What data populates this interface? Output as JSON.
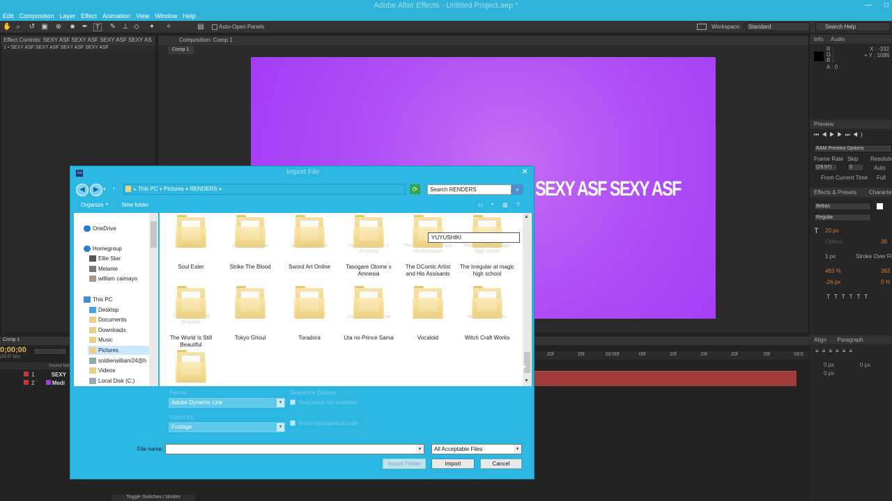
{
  "app": {
    "title": "Adobe After Effects - Untitled Project.aep *",
    "window_min": "—",
    "window_max": "□"
  },
  "menu": [
    "Edit",
    "Composition",
    "Layer",
    "Effect",
    "Animation",
    "View",
    "Window",
    "Help"
  ],
  "toolbar": {
    "auto_open": "Auto-Open Panels",
    "workspace_label": "Workspace:",
    "workspace_value": "Standard",
    "search_help": "Search Help"
  },
  "left_panel": {
    "tab": "Effect Controls: SEXY ASF SEXY ASF SEXY ASF SEXY AS",
    "breadcrumb": "1 • SEXY ASF SEXY ASF SEXY ASF SEXY ASF"
  },
  "comp_panel": {
    "tab": "Composition: Comp 1",
    "subtab": "Comp 1",
    "text": "SEXY ASF SEXY ASF"
  },
  "timeline": {
    "tab": "Comp 1",
    "time": "0;00;00",
    "fps": "(29.97 fps)",
    "col_source": "Source Nam",
    "layers": [
      {
        "num": "1",
        "name": "SEXY"
      },
      {
        "num": "2",
        "name": "Medi"
      }
    ],
    "ruler": [
      "20f",
      "25f",
      "02:00f",
      "05f",
      "10f",
      "15f",
      "20f",
      "25f",
      "03:0"
    ],
    "toggle": "Toggle Switches / Modes"
  },
  "right_panel": {
    "info_tab": "Info",
    "audio_tab": "Audio",
    "r": "R :",
    "g": "G :",
    "b": "B :",
    "a": "A : 0",
    "x": "X : -332",
    "y": "+ Y : 1086",
    "preview_tab": "Preview",
    "ram": "RAM Preview Options",
    "frame_rate": "Frame Rate",
    "skip": "Skip",
    "resolution": "Resolutio",
    "fr_val": "(29.97)",
    "skip_val": "0",
    "res_val": "Auto",
    "from_current": "From Current Time",
    "full": "Full",
    "effects_tab": "Effects & Presets",
    "char_tab": "Characte",
    "font": "Bebas",
    "style": "Regular",
    "size": "20 px",
    "tracking": "Optical",
    "leading": "36",
    "stroke": "1 px",
    "stroke_over": "Stroke Over Fil",
    "vscale": "483 %",
    "hscale": "363",
    "baseline": "-26 px",
    "tsume": "0 %",
    "align_tab": "Align",
    "para_tab": "Paragraph",
    "indent1": "0 px",
    "indent2": "0 px",
    "indent3": "0 px"
  },
  "dialog": {
    "title": "Import File",
    "close": "✕",
    "breadcrumb": [
      "This PC",
      "Pictures",
      "RENDERS"
    ],
    "search_placeholder": "Search RENDERS",
    "organize": "Organize",
    "new_folder": "New folder",
    "nav": [
      "OneDrive",
      "Homegroup",
      "Ellie Star",
      "Melanie",
      "william caimayo",
      "This PC",
      "Desktop",
      "Documents",
      "Downloads",
      "Music",
      "Pictures",
      "soldierwilliam24@h",
      "Videos",
      "Local Disk (C:)"
    ],
    "folders": [
      {
        "label": "Soul Eater",
        "ghost": "Soul Eater"
      },
      {
        "label": "Strike The Blood",
        "ghost": "Strike The Blood"
      },
      {
        "label": "Sword Art Online",
        "ghost": "Sword Art Online"
      },
      {
        "label": "Tasogare Otome x Amnesia",
        "ghost": "Tasogare Otome x Amnesia"
      },
      {
        "label": "The DComic Artist and His Assisants",
        "ghost": "The DComic Artist and His Assisants"
      },
      {
        "label": "The Irregular at magic high school",
        "ghost": "The Irregular at magic high school"
      },
      {
        "label": "The World Is Still Beautiful",
        "ghost": "The World Is Still Beautiful"
      },
      {
        "label": "Tokyo Ghoul",
        "ghost": "Tokyo Ghoul"
      },
      {
        "label": "Toradora",
        "ghost": "Toradora"
      },
      {
        "label": "Uta no Prince Sama",
        "ghost": "Uta no Prince Sama"
      },
      {
        "label": "Vocaloid",
        "ghost": "Vocaloid"
      },
      {
        "label": "Witch Craft Works",
        "ghost": "Witch Craft Works"
      },
      {
        "label": "",
        "ghost": "YUYUSHIKI"
      }
    ],
    "rename_value": "YUYUSHIKI",
    "format_label": "Format:",
    "format_value": "Adobe Dynamic Link",
    "import_as_label": "Import As:",
    "import_as_value": "Footage",
    "seq_options": "Sequence Options:",
    "seq_not": "Sequence not available",
    "force_alpha": "Force alphabetical order",
    "filename_label": "File name:",
    "filename_value": "",
    "filetype": "All Acceptable Files",
    "import_folder": "Import Folder",
    "import": "Import",
    "cancel": "Cancel"
  }
}
